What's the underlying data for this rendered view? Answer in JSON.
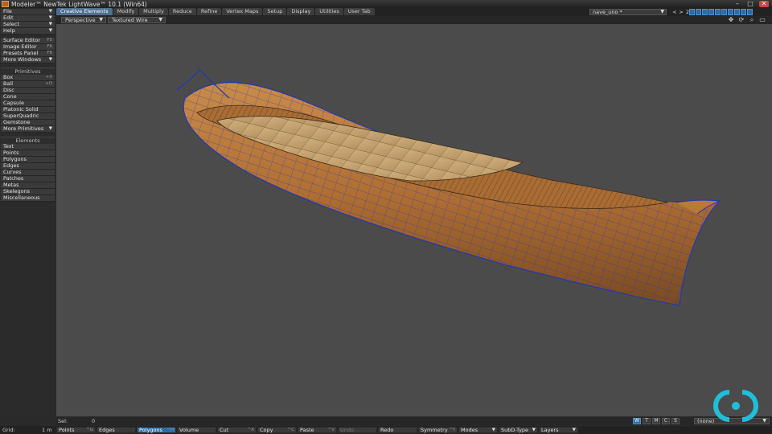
{
  "app": {
    "title": "Modeler™ NewTek LightWave™ 10.1 (Win64)"
  },
  "window_controls": {
    "minimize": "–",
    "maximize": "□",
    "close": "✕"
  },
  "tabs": [
    {
      "label": "Creative Elements",
      "active": true
    },
    {
      "label": "Modify"
    },
    {
      "label": "Multiply"
    },
    {
      "label": "Reduce"
    },
    {
      "label": "Refine"
    },
    {
      "label": "Vertex Maps"
    },
    {
      "label": "Setup"
    },
    {
      "label": "Display"
    },
    {
      "label": "Utilities"
    },
    {
      "label": "User Tab"
    }
  ],
  "scene": {
    "object": "nave_uno *",
    "prev": "<",
    "next": ">",
    "layer_page": "2"
  },
  "sidebar": {
    "menus": [
      {
        "label": "File",
        "dropdown": true
      },
      {
        "label": "Edit",
        "dropdown": true
      },
      {
        "label": "Select",
        "dropdown": true
      },
      {
        "label": "Help",
        "dropdown": true
      }
    ],
    "editors": [
      {
        "label": "Surface Editor",
        "shortcut": "F5"
      },
      {
        "label": "Image Editor",
        "shortcut": "F6"
      },
      {
        "label": "Presets Panel",
        "shortcut": "F8"
      },
      {
        "label": "More Windows",
        "dropdown": true
      }
    ],
    "primitives_header": "Primitives",
    "primitives": [
      {
        "label": "Box",
        "shortcut": "+X"
      },
      {
        "label": "Ball",
        "shortcut": "+O"
      },
      {
        "label": "Disc"
      },
      {
        "label": "Cone"
      },
      {
        "label": "Capsule"
      },
      {
        "label": "Platonic Solid"
      },
      {
        "label": "SuperQuadric"
      },
      {
        "label": "Gemstone"
      },
      {
        "label": "More Primitives",
        "dropdown": true
      }
    ],
    "elements_header": "Elements",
    "elements": [
      {
        "label": "Text"
      },
      {
        "label": "Points"
      },
      {
        "label": "Polygons"
      },
      {
        "label": "Edges"
      },
      {
        "label": "Curves"
      },
      {
        "label": "Patches"
      },
      {
        "label": "Metas"
      },
      {
        "label": "Skelegons"
      },
      {
        "label": "Miscellaneous"
      }
    ]
  },
  "viewport": {
    "view": "Perspective",
    "shading": "Textured Wire"
  },
  "status": {
    "sel_label": "Sel:",
    "sel_value": "0",
    "wtmcs": [
      "W",
      "T",
      "M",
      "C",
      "S"
    ],
    "active_wtmcs": "W",
    "surface": "(none)"
  },
  "bottom": {
    "grid_label": "Grid:",
    "grid_value": "1 m",
    "buttons": [
      {
        "label": "Points",
        "shortcut": "^G"
      },
      {
        "label": "Edges"
      },
      {
        "label": "Polygons",
        "shortcut": "^H",
        "active": true
      },
      {
        "label": "Volume"
      },
      {
        "label": "Cut",
        "shortcut": "^X"
      },
      {
        "label": "Copy",
        "shortcut": "^C"
      },
      {
        "label": "Paste",
        "shortcut": "^V"
      },
      {
        "label": "Undo",
        "disabled": true
      },
      {
        "label": "Redo"
      },
      {
        "label": "Symmetry",
        "shortcut": "^Y"
      },
      {
        "label": "Modes",
        "dropdown": true
      },
      {
        "label": "SubD-Type",
        "dropdown": true
      },
      {
        "label": "Layers",
        "dropdown": true
      }
    ]
  },
  "colors": {
    "accent": "#2b6da8",
    "viewport_bg": "#4b4b4b",
    "wire": "#1f3fb8",
    "wood": "#b9793a",
    "logo": "#1fbfd8"
  },
  "icons": [
    "app-icon",
    "move-view-icon",
    "rotate-view-icon",
    "zoom-view-icon",
    "maximize-view-icon",
    "logo-icon"
  ]
}
